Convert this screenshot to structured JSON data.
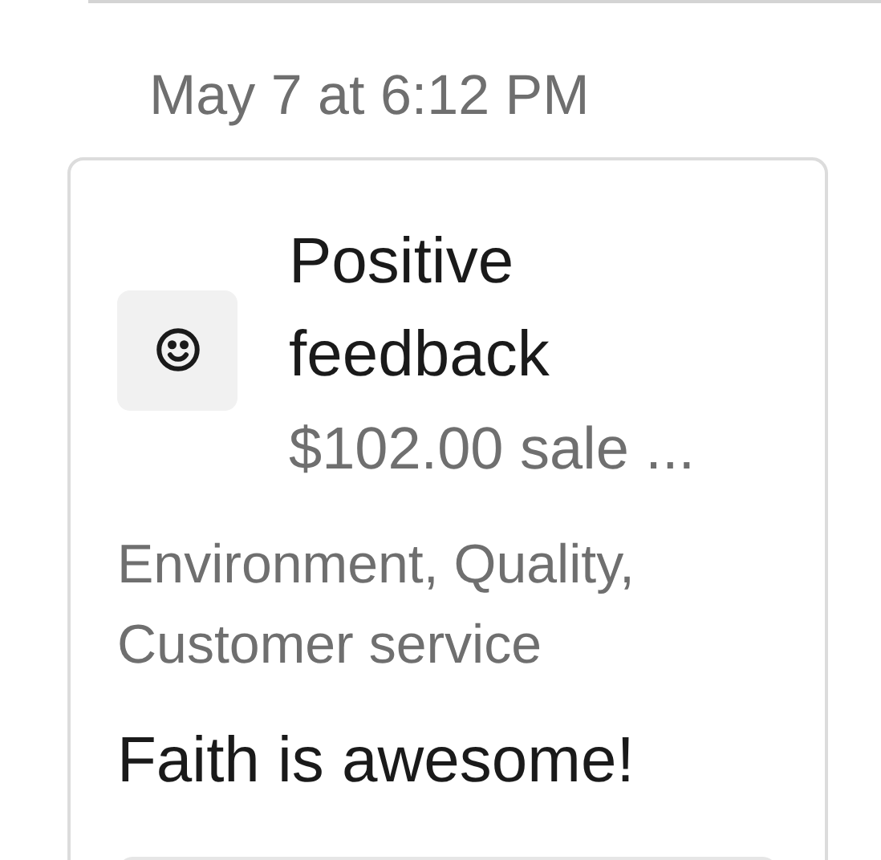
{
  "timestamp": "May 7 at 6:12 PM",
  "card": {
    "title": "Positive feedback",
    "subtitle": "$102.00 sale ...",
    "tags": "Environment, Quality, Customer service",
    "comment": "Faith is awesome!"
  }
}
